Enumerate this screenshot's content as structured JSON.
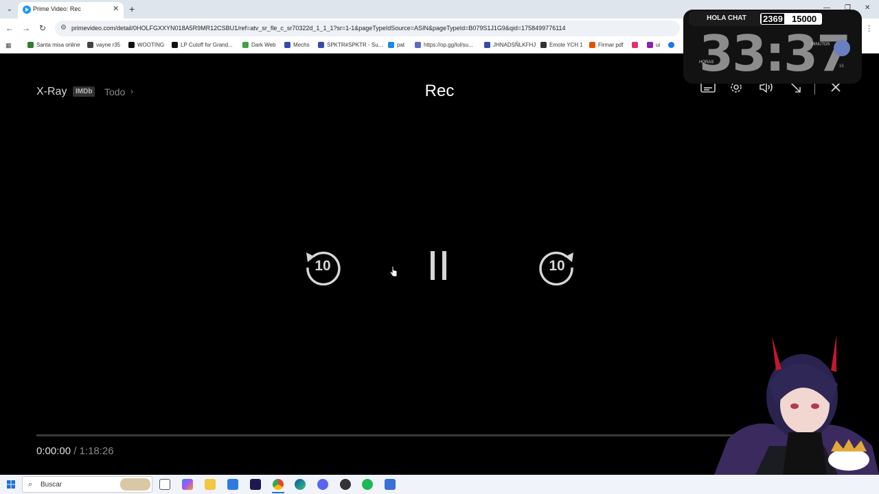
{
  "browser": {
    "tab_title": "Prime Video: Rec",
    "url": "primevideo.com/detail/0HOLFGXXYN018A5R9MR12CSBU1/ref=atv_sr_fle_c_sr70322d_1_1_1?sr=1-1&pageTypeIdSource=ASIN&pageTypeId=B079S1J1G9&qid=1758499776114",
    "bookmarks": [
      {
        "label": "Santa misa online",
        "color": "#2e7d32"
      },
      {
        "label": "vayne r35",
        "color": "#444444"
      },
      {
        "label": "WOOTING",
        "color": "#111111"
      },
      {
        "label": "LP Cutoff for Grand...",
        "color": "#111111"
      },
      {
        "label": "Dark Web",
        "color": "#43a047"
      },
      {
        "label": "Mechs",
        "color": "#3949ab"
      },
      {
        "label": "SPKTR#SPKTR - Su...",
        "color": "#3949ab"
      },
      {
        "label": "pat",
        "color": "#1e88e5"
      },
      {
        "label": "https://op.gg/lol/su...",
        "color": "#5c6bc0"
      },
      {
        "label": "JHNADSÑLKFHJ",
        "color": "#3949ab"
      },
      {
        "label": "Emote YCH 1",
        "color": "#333333"
      },
      {
        "label": "Firmar pdf",
        "color": "#e65100"
      },
      {
        "label": "ui",
        "color": "#8e24aa"
      }
    ]
  },
  "player": {
    "xray_label": "X-Ray",
    "imdb_label": "IMDb",
    "todo_label": "Todo",
    "title": "Rec",
    "rewind_label": "10",
    "forward_label": "10",
    "current_time": "0:00:00",
    "time_separator": "/",
    "duration": "1:18:26",
    "progress": 0
  },
  "overlay": {
    "tag": "HOLA CHAT",
    "count_current": "2369",
    "count_goal": "15000",
    "timer": "33:37",
    "label_hours": "HORAS",
    "label_minutes": "MINUTOS",
    "dial_value": "15"
  },
  "taskbar": {
    "search_label": "Buscar"
  }
}
